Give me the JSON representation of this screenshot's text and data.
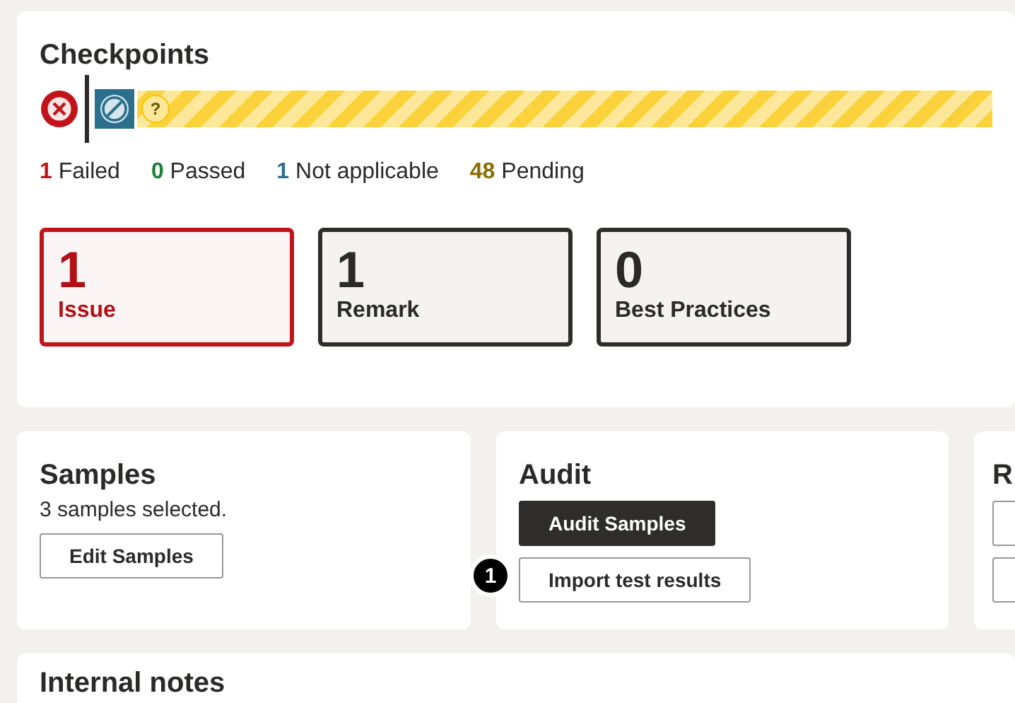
{
  "checkpoints": {
    "title": "Checkpoints",
    "bar": [
      {
        "kind": "failed"
      },
      {
        "kind": "not_applicable"
      },
      {
        "kind": "pending",
        "symbol": "?"
      }
    ],
    "counts": [
      {
        "text": "**1** Failed",
        "color": "#c0141a"
      },
      {
        "text": "**0** Passed",
        "color": "#1a7f37"
      },
      {
        "text": "**1** Not applicable",
        "color": "#2a6f8c"
      },
      {
        "text": "**48** Pending",
        "color": "#8a6d00"
      }
    ],
    "summary": [
      {
        "value": "1",
        "label": "Issue",
        "kind": "issue"
      },
      {
        "value": "1",
        "label": "Remark",
        "kind": "plain"
      },
      {
        "value": "0",
        "label": "Best Practices",
        "kind": "plain"
      }
    ]
  },
  "samples": {
    "title": "Samples",
    "text": "3 samples selected.",
    "buttons": [
      {
        "label": "Edit Samples",
        "kind": "secondary"
      }
    ]
  },
  "audit": {
    "title": "Audit",
    "buttons": [
      {
        "label": "Audit Samples",
        "kind": "primary"
      },
      {
        "label": "Import test results",
        "kind": "secondary",
        "badge": "1"
      }
    ]
  },
  "third_panel": {
    "title": "R",
    "buttons": [
      {
        "kind": "secondary"
      },
      {
        "kind": "secondary"
      }
    ]
  },
  "internal_notes": {
    "title": "Internal notes"
  }
}
